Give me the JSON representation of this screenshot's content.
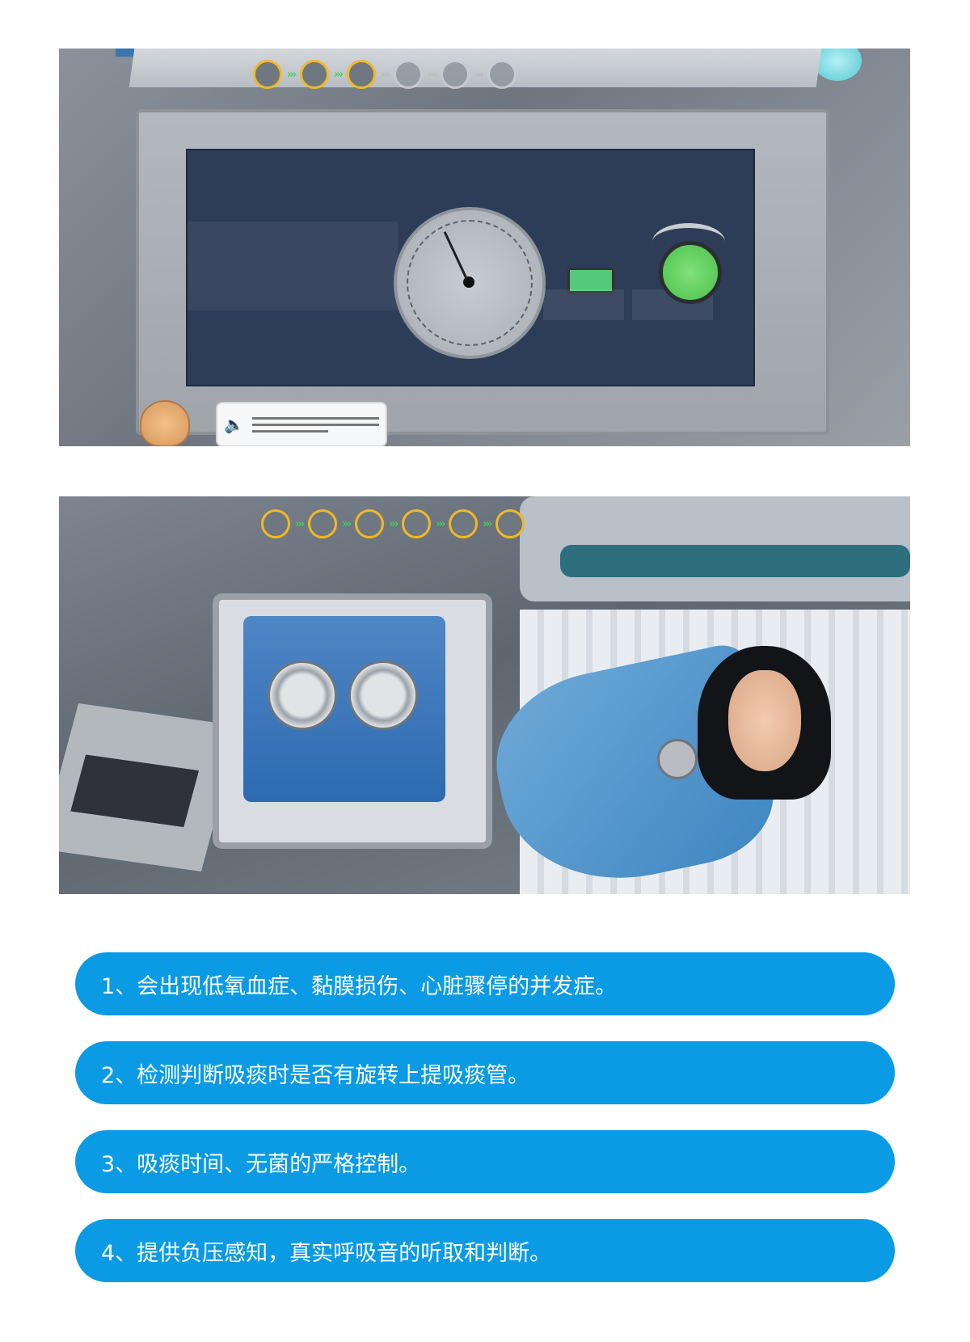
{
  "screenshot1": {
    "progress": [
      {
        "state": "done"
      },
      {
        "state": "done"
      },
      {
        "state": "current"
      },
      {
        "state": "pending"
      },
      {
        "state": "pending"
      },
      {
        "state": "pending"
      }
    ],
    "icons": {
      "speaker": "speaker-icon",
      "mascot": "doctor-avatar-icon"
    }
  },
  "screenshot2": {
    "progress": [
      {
        "state": "done"
      },
      {
        "state": "done"
      },
      {
        "state": "done"
      },
      {
        "state": "done"
      },
      {
        "state": "done"
      },
      {
        "state": "done"
      }
    ]
  },
  "features": [
    "1、会出现低氧血症、黏膜损伤、心脏骤停的并发症。",
    "2、检测判断吸痰时是否有旋转上提吸痰管。",
    "3、吸痰时间、无菌的严格控制。",
    "4、提供负压感知，真实呼吸音的听取和判断。"
  ],
  "colors": {
    "pill": "#0a9be4",
    "progress_active": "#f2b824",
    "arrow_active": "#3fd25a"
  }
}
